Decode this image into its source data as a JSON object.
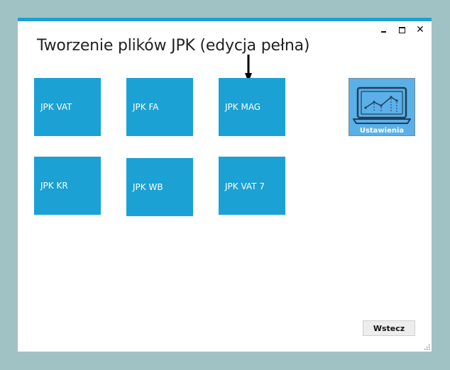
{
  "window": {
    "title": "Tworzenie plików JPK (edycja pełna)",
    "controls": {
      "minimize": "",
      "maximize": "",
      "close": "✕"
    }
  },
  "tiles": [
    {
      "label": "JPK VAT"
    },
    {
      "label": "JPK FA"
    },
    {
      "label": "JPK MAG"
    },
    {
      "label": "JPK KR"
    },
    {
      "label": "JPK WB"
    },
    {
      "label": "JPK VAT 7"
    }
  ],
  "settings": {
    "label": "Ustawienia",
    "icon": "laptop-chart-icon"
  },
  "footer": {
    "back_label": "Wstecz"
  },
  "colors": {
    "tile": "#1ba1d3",
    "settings_tile": "#5bb0e8",
    "background": "#a1c2c5",
    "accent_bar": "#1ba1d3"
  }
}
